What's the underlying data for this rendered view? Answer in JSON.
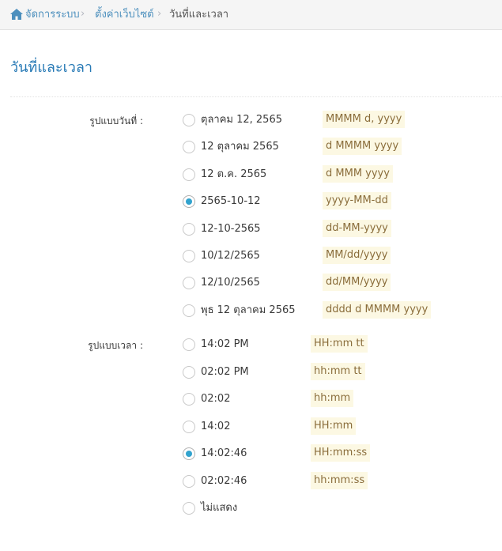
{
  "colors": {
    "link": "#4c8fbd",
    "title": "#2679b5",
    "format_bg": "#fcf8e3",
    "radio_checked": "#32a3ce"
  },
  "breadcrumb": {
    "home_icon": "home-icon",
    "items": [
      {
        "label": "จัดการระบบ"
      },
      {
        "label": "ตั้งค่าเว็บไซต์"
      },
      {
        "label": "วันที่และเวลา"
      }
    ]
  },
  "page_title": "วันที่และเวลา",
  "date_format": {
    "label": "รูปแบบวันที่ :",
    "options": [
      {
        "label": "ตุลาคม 12, 2565",
        "format": "MMMM d, yyyy",
        "checked": false
      },
      {
        "label": "12 ตุลาคม 2565",
        "format": "d MMMM yyyy",
        "checked": false
      },
      {
        "label": "12 ต.ค. 2565",
        "format": "d MMM yyyy",
        "checked": false
      },
      {
        "label": "2565-10-12",
        "format": "yyyy-MM-dd",
        "checked": true
      },
      {
        "label": "12-10-2565",
        "format": "dd-MM-yyyy",
        "checked": false
      },
      {
        "label": "10/12/2565",
        "format": "MM/dd/yyyy",
        "checked": false
      },
      {
        "label": "12/10/2565",
        "format": "dd/MM/yyyy",
        "checked": false
      },
      {
        "label": "พุธ 12 ตุลาคม 2565",
        "format": "dddd d MMMM yyyy",
        "checked": false
      }
    ]
  },
  "time_format": {
    "label": "รูปแบบเวลา :",
    "options": [
      {
        "label": "14:02 PM",
        "format": "HH:mm tt",
        "checked": false
      },
      {
        "label": "02:02 PM",
        "format": "hh:mm tt",
        "checked": false
      },
      {
        "label": "02:02",
        "format": "hh:mm",
        "checked": false
      },
      {
        "label": "14:02",
        "format": "HH:mm",
        "checked": false
      },
      {
        "label": "14:02:46",
        "format": "HH:mm:ss",
        "checked": true
      },
      {
        "label": "02:02:46",
        "format": "hh:mm:ss",
        "checked": false
      },
      {
        "label": "ไม่แสดง",
        "format": "",
        "checked": false
      }
    ]
  }
}
